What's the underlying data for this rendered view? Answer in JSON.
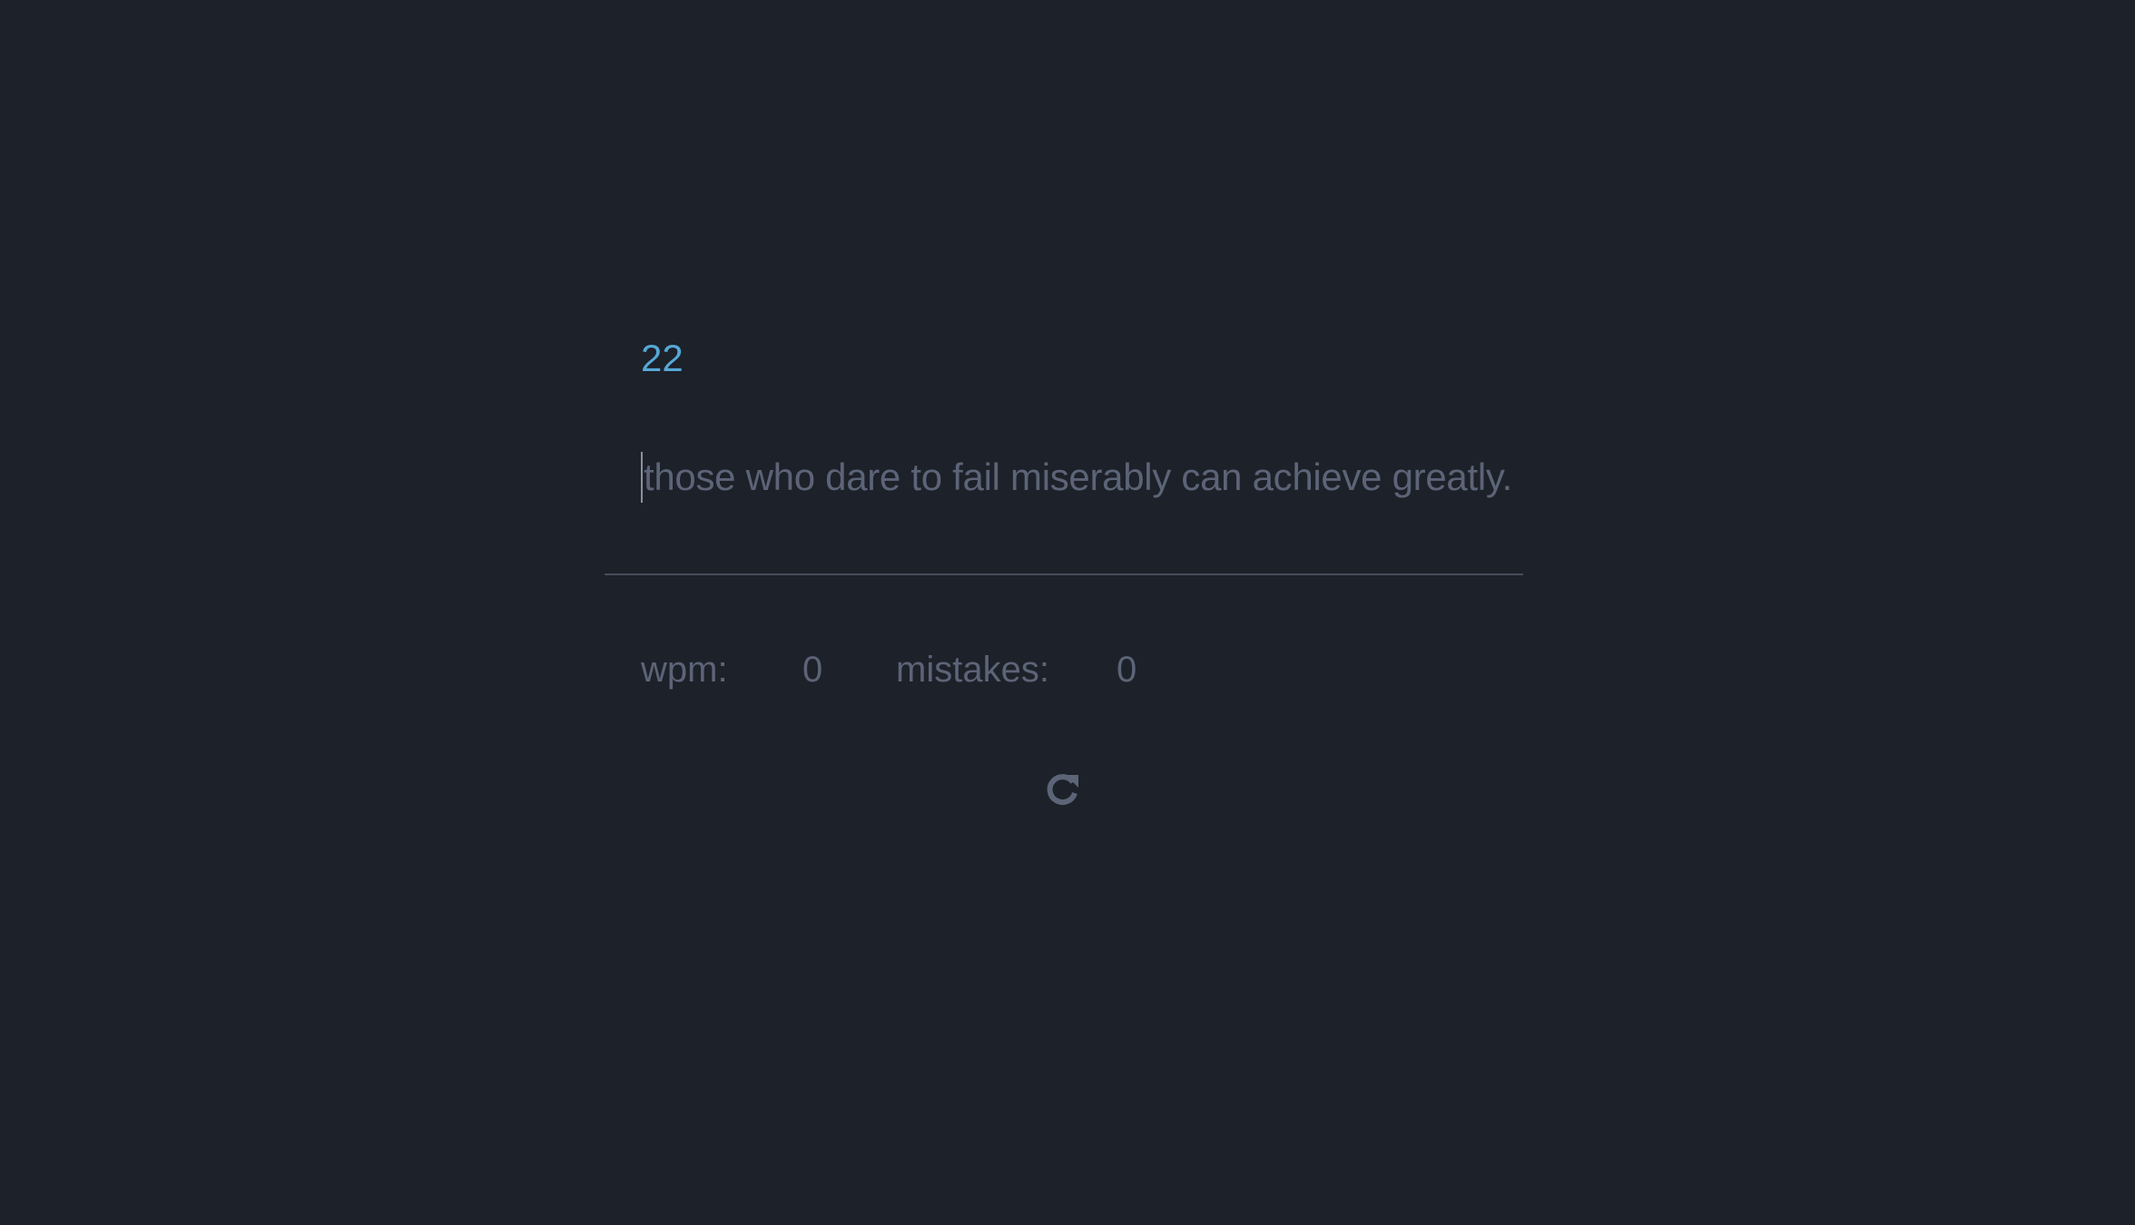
{
  "timer": {
    "value": "22"
  },
  "typing": {
    "quote": "those who dare to fail miserably can achieve greatly."
  },
  "stats": {
    "wpm_label": "wpm:",
    "wpm_value": "0",
    "mistakes_label": "mistakes:",
    "mistakes_value": "0"
  },
  "controls": {
    "restart_icon": "restart-icon"
  },
  "colors": {
    "background": "#1d2129",
    "accent": "#55a8d6",
    "text_muted": "#5c6477",
    "divider": "#474d59"
  }
}
